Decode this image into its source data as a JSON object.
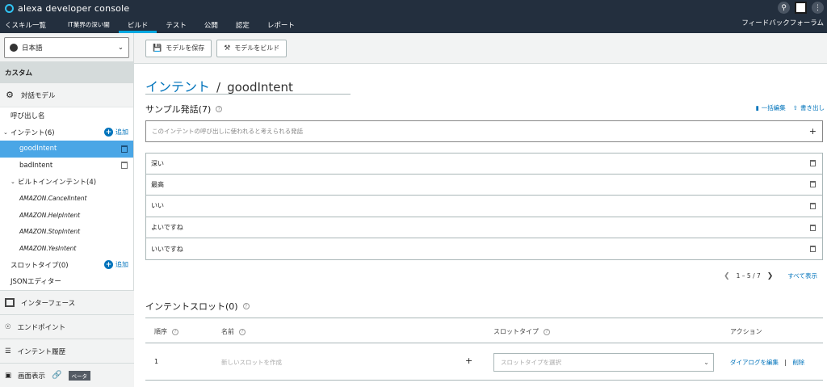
{
  "header": {
    "brand": "alexa developer console",
    "tabs": [
      {
        "label": "くスキル一覧"
      },
      {
        "label": "IT業界の深い闇"
      },
      {
        "label": "ビルド"
      },
      {
        "label": "テスト"
      },
      {
        "label": "公開"
      },
      {
        "label": "認定"
      },
      {
        "label": "レポート"
      }
    ],
    "feedback": "フィードバックフォーラム"
  },
  "sidebar": {
    "language": "日本語",
    "custom": "カスタム",
    "interaction_model": "対話モデル",
    "invocation": "呼び出し名",
    "intents": "インテント(6)",
    "add": "追加",
    "intent_items": [
      "goodIntent",
      "badIntent"
    ],
    "builtin_label": "ビルトインインテント(4)",
    "builtin_items": [
      "AMAZON.CancelIntent",
      "AMAZON.HelpIntent",
      "AMAZON.StopIntent",
      "AMAZON.YesIntent"
    ],
    "slot_types": "スロットタイプ(0)",
    "json_editor": "JSONエディター",
    "interfaces": "インターフェース",
    "endpoint": "エンドポイント",
    "intent_history": "インテント履歴",
    "display": "画面表示",
    "beta": "ベータ"
  },
  "toolbar": {
    "save": "モデルを保存",
    "build": "モデルをビルド"
  },
  "intent": {
    "crumb": "インテント",
    "sep": "/",
    "name": "goodIntent"
  },
  "utterances": {
    "title": "サンプル発話(7)",
    "bulk_edit": "一括編集",
    "export": "書き出し",
    "placeholder": "このインテントの呼び出しに使われると考えられる発話",
    "plus": "+",
    "items": [
      "深い",
      "最高",
      "いい",
      "よいですね",
      "いいですね"
    ],
    "pager": "1 – 5 / 7",
    "show_all": "すべて表示"
  },
  "slots": {
    "title": "インテントスロット(0)",
    "col_order": "順序",
    "col_name": "名前",
    "col_type": "スロットタイプ",
    "col_action": "アクション",
    "row_order": "1",
    "row_name_placeholder": "新しいスロットを作成",
    "row_plus": "+",
    "row_type_placeholder": "スロットタイプを選択",
    "dialog_edit": "ダイアログを編集",
    "bar": "|",
    "delete": "削除"
  }
}
